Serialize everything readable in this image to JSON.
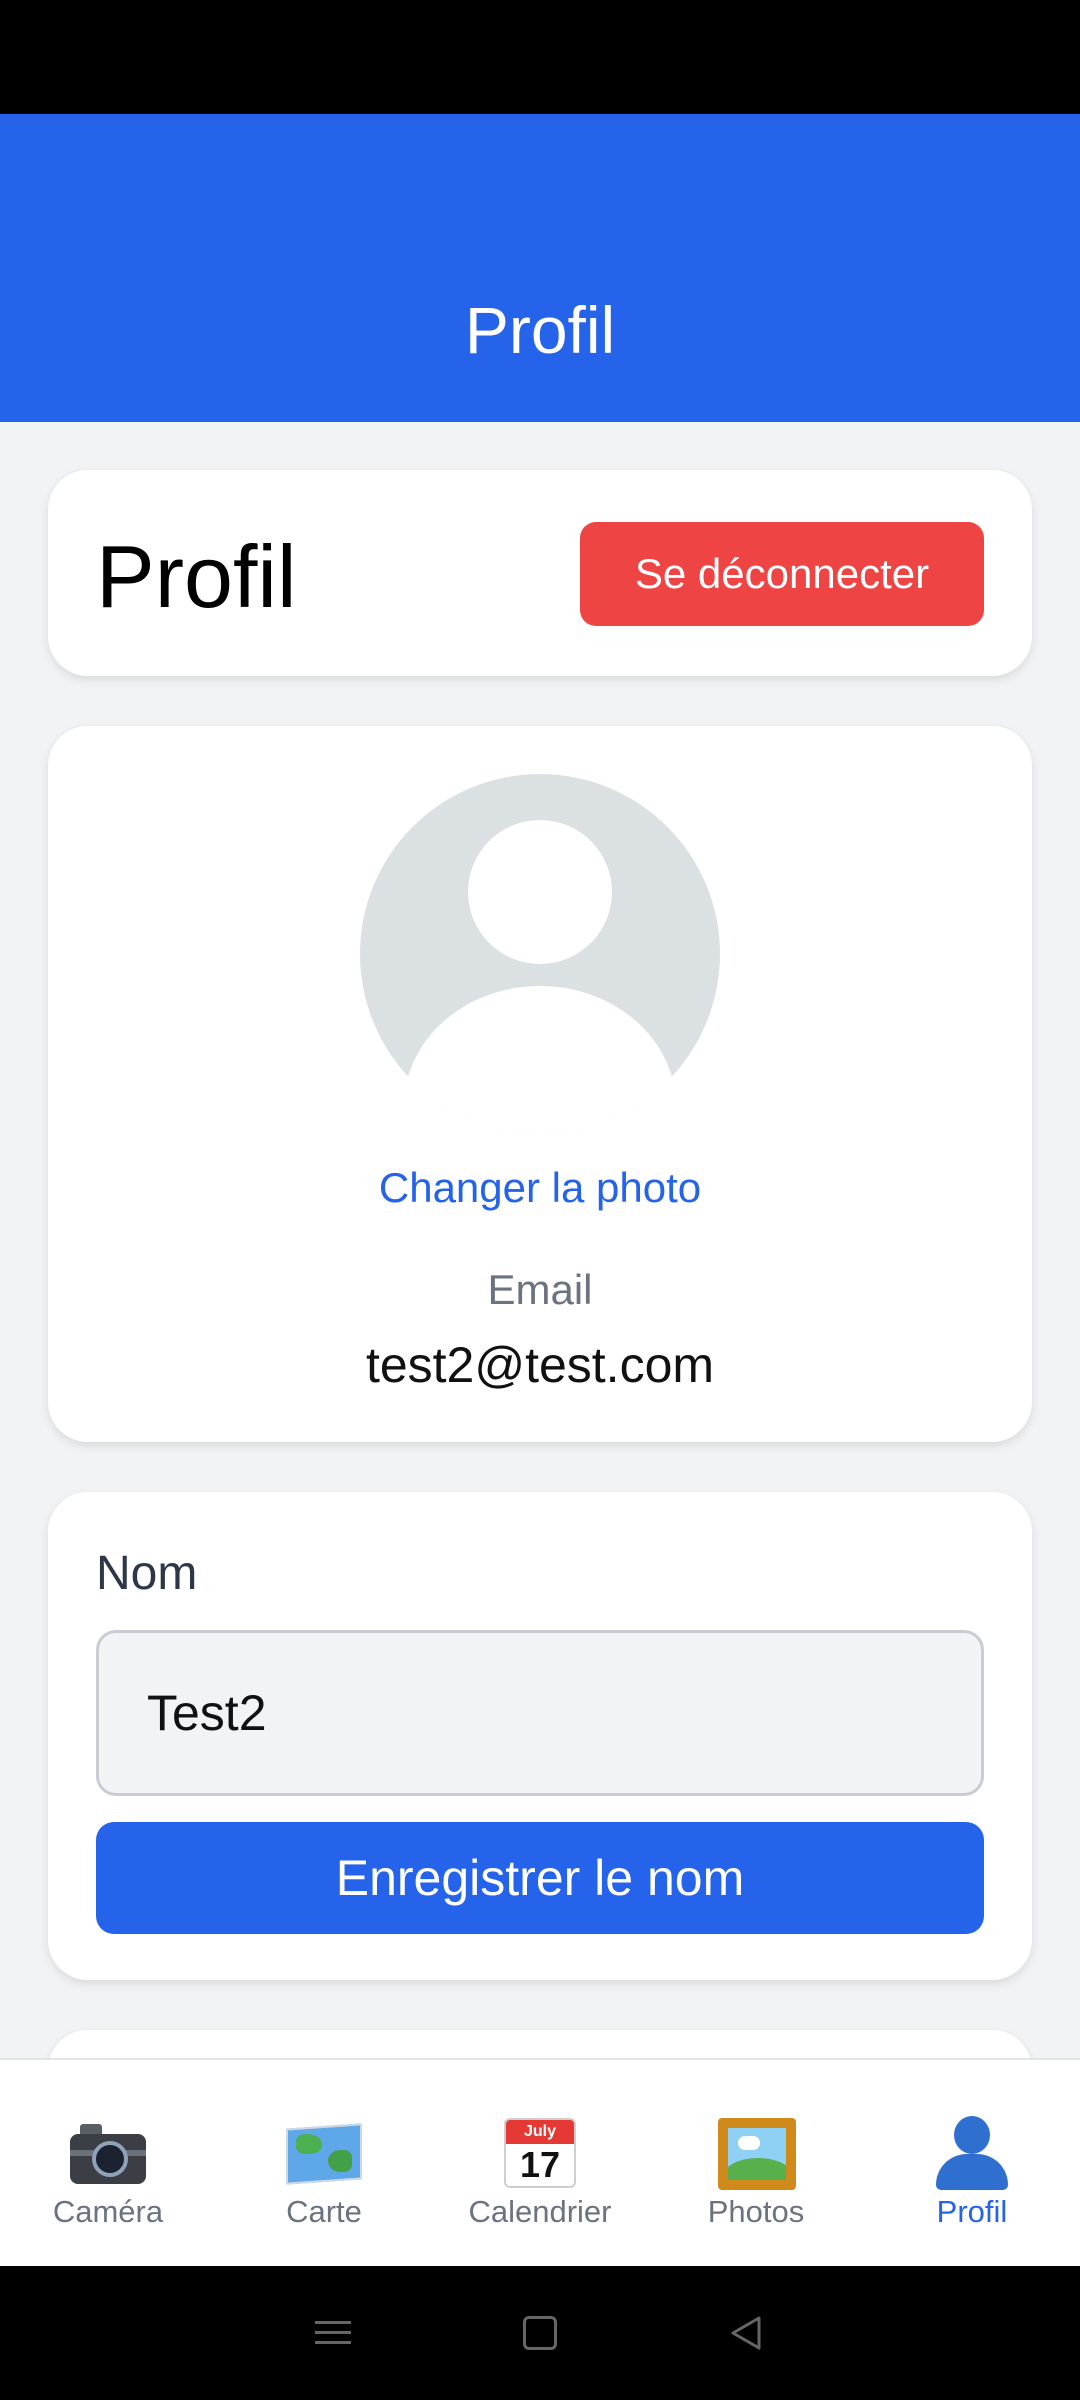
{
  "header": {
    "title": "Profil"
  },
  "profile_card": {
    "title": "Profil",
    "logout_label": "Se déconnecter"
  },
  "photo_card": {
    "change_photo_label": "Changer la photo",
    "email_label": "Email",
    "email_value": "test2@test.com"
  },
  "name_card": {
    "label": "Nom",
    "input_value": "Test2",
    "save_label": "Enregistrer le nom"
  },
  "bottom_nav": {
    "items": [
      {
        "label": "Caméra",
        "icon": "camera-icon",
        "active": false
      },
      {
        "label": "Carte",
        "icon": "map-icon",
        "active": false
      },
      {
        "label": "Calendrier",
        "icon": "calendar-icon",
        "active": false,
        "icon_month": "July",
        "icon_day": "17"
      },
      {
        "label": "Photos",
        "icon": "photos-icon",
        "active": false
      },
      {
        "label": "Profil",
        "icon": "profile-icon",
        "active": true
      }
    ]
  },
  "colors": {
    "primary": "#2563eb",
    "danger": "#ef4444",
    "background": "#f2f3f5"
  }
}
